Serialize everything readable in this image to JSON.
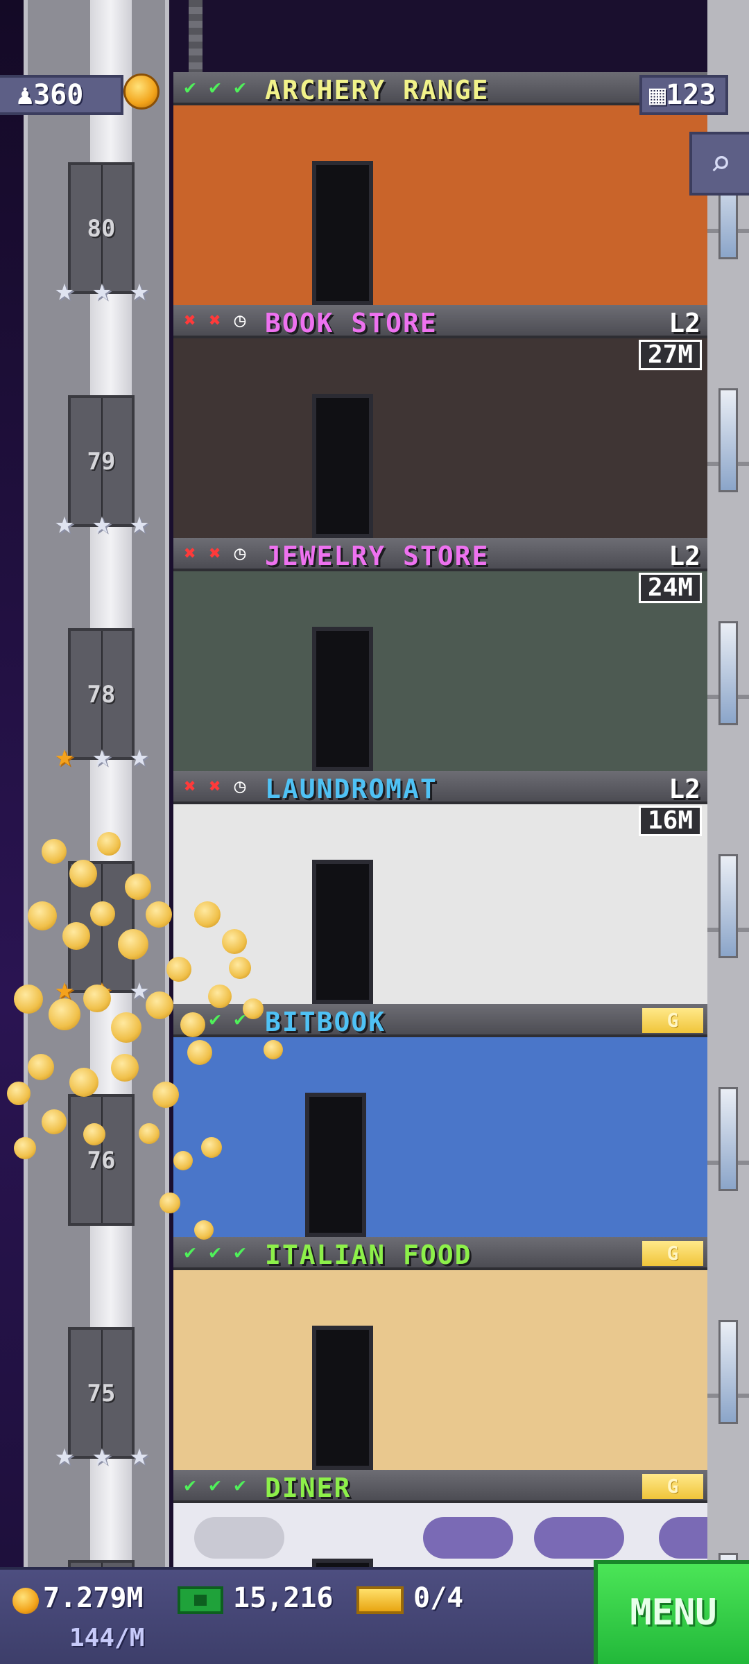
{
  "hud": {
    "population": "360",
    "floors_count": "123",
    "coins": "7.279M",
    "coin_rate": "144/M",
    "bux": "15,216",
    "tickets": "0/4",
    "menu_label": "MENU"
  },
  "floors": [
    {
      "name": "ARCHERY RANGE",
      "name_color": "#f1f28a",
      "checks": [
        "ok",
        "ok",
        "ok"
      ],
      "level": "",
      "time": "",
      "gold": false,
      "elevator_floor": "80",
      "stars": [
        "silver",
        "silver",
        "silver"
      ]
    },
    {
      "name": "BOOK STORE",
      "name_color": "#ee72f0",
      "checks": [
        "no",
        "no",
        "time"
      ],
      "level": "L2",
      "time": "27M",
      "gold": false,
      "elevator_floor": "79",
      "stars": [
        "silver",
        "silver",
        "silver"
      ]
    },
    {
      "name": "JEWELRY STORE",
      "name_color": "#ee72f0",
      "checks": [
        "no",
        "no",
        "time"
      ],
      "level": "L2",
      "time": "24M",
      "gold": false,
      "elevator_floor": "78",
      "stars": [
        "gold",
        "silver",
        "silver"
      ]
    },
    {
      "name": "LAUNDROMAT",
      "name_color": "#4fc2f5",
      "checks": [
        "no",
        "no",
        "time"
      ],
      "level": "L2",
      "time": "16M",
      "gold": false,
      "elevator_floor": "",
      "stars": [
        "gold",
        "gold",
        "silver"
      ]
    },
    {
      "name": "BITBOOK",
      "name_color": "#4fc2f5",
      "checks": [
        "ok",
        "ok",
        "ok"
      ],
      "level": "",
      "time": "",
      "gold": true,
      "gold_label": "G",
      "elevator_floor": "76",
      "stars": []
    },
    {
      "name": "ITALIAN FOOD",
      "name_color": "#8df04a",
      "checks": [
        "ok",
        "ok",
        "ok"
      ],
      "level": "",
      "time": "",
      "gold": true,
      "gold_label": "G",
      "elevator_floor": "75",
      "stars": [
        "silver",
        "silver",
        "silver"
      ]
    },
    {
      "name": "DINER",
      "name_color": "#8df04a",
      "checks": [
        "ok",
        "ok",
        "ok"
      ],
      "level": "",
      "time": "",
      "gold": true,
      "gold_label": "G",
      "elevator_floor": "",
      "stars": [
        "gold",
        "gold",
        "silver"
      ]
    }
  ],
  "colors": {
    "archery_bg": "#c9642a",
    "bookstore_bg": "#3f3534",
    "jewelry_bg": "#4d5a52",
    "laundromat_bg": "#e6e6e6",
    "bitbook_bg": "#4a76c9",
    "italian_bg": "#e9c88e",
    "diner_bg": "#e8e8f0"
  },
  "icons": {
    "population": "person-icon",
    "floors": "building-icon",
    "search": "magnifier-icon",
    "check": "check-icon",
    "cross": "cross-icon",
    "clock": "clock-icon",
    "coin": "coin-icon",
    "bux": "bux-icon",
    "ticket": "ticket-icon",
    "star": "star-icon"
  }
}
